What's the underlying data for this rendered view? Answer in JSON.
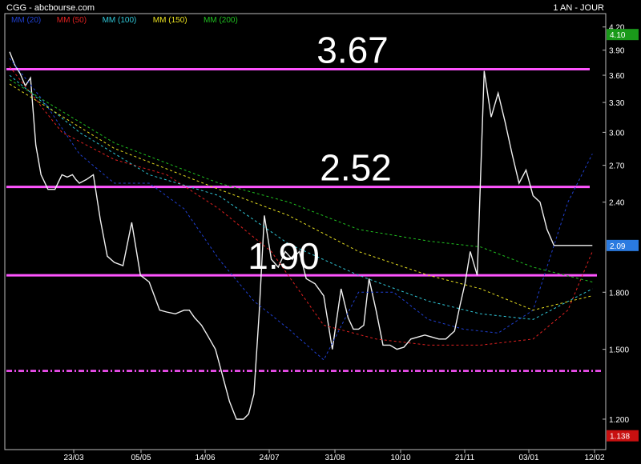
{
  "header": {
    "title": "CGG - abcbourse.com",
    "period": "1 AN - JOUR"
  },
  "chart_data": {
    "type": "line",
    "title": "CGG - abcbourse.com",
    "period": "1 AN - JOUR",
    "y_scale": "log",
    "ylim": [
      1.1,
      4.35
    ],
    "y_ticks": [
      4.2,
      3.9,
      3.6,
      3.3,
      3.0,
      2.7,
      2.4,
      1.8,
      1.5,
      1.2
    ],
    "y_tick_labels": [
      "4.20",
      "3.90",
      "3.60",
      "3.30",
      "3.00",
      "2.70",
      "2.40",
      "1.800",
      "1.500",
      "1.200"
    ],
    "x_tick_labels": [
      "23/03",
      "05/05",
      "14/06",
      "24/07",
      "31/08",
      "10/10",
      "21/11",
      "03/01",
      "12/02"
    ],
    "grid": false,
    "legend_position": "top-left",
    "legend": [
      {
        "label": "MM (20)",
        "color": "#1f3fd0"
      },
      {
        "label": "MM (50)",
        "color": "#e02020"
      },
      {
        "label": "MM (100)",
        "color": "#30c8d8"
      },
      {
        "label": "MM (150)",
        "color": "#e8e020"
      },
      {
        "label": "MM (200)",
        "color": "#20c020"
      }
    ],
    "price_badges": [
      {
        "label": "4.10",
        "value": 4.1,
        "color": "#1a9a1a"
      },
      {
        "label": "2.09",
        "value": 2.09,
        "color": "#2a7ae0"
      },
      {
        "label": "1.138",
        "value": 1.138,
        "color": "#c81010"
      }
    ],
    "annotations": [
      {
        "label": "3.67",
        "value": 3.67
      },
      {
        "label": "2.52",
        "value": 2.52
      },
      {
        "label": "1.90",
        "value": 1.9
      }
    ],
    "horizontal_lines": [
      {
        "value": 3.67,
        "style": "solid",
        "color": "#ff55ff"
      },
      {
        "value": 2.52,
        "style": "solid",
        "color": "#ff55ff"
      },
      {
        "value": 1.9,
        "style": "solid",
        "color": "#ff55ff"
      },
      {
        "value": 1.4,
        "style": "dash-dot",
        "color": "#ff55ff"
      }
    ],
    "series": [
      {
        "name": "Cours",
        "color": "#f0f0f0",
        "x": [
          0,
          3,
          6,
          9,
          12,
          15,
          18,
          22,
          26,
          30,
          33,
          36,
          38,
          40,
          44,
          48,
          52,
          56,
          60,
          65,
          70,
          75,
          80,
          86,
          90,
          95,
          100,
          103,
          106,
          110,
          114,
          118,
          122,
          126,
          130,
          134,
          137,
          140,
          143,
          146,
          150,
          154,
          158,
          162,
          166,
          170,
          175,
          180,
          185,
          190,
          194,
          197,
          200,
          203,
          206,
          210,
          214,
          218,
          222,
          226,
          230,
          234,
          238,
          242,
          246,
          250,
          255,
          258,
          261,
          264,
          268,
          272,
          276,
          280,
          284,
          288,
          292,
          296,
          300,
          304,
          308,
          312,
          316,
          320,
          324,
          326,
          328,
          330,
          332,
          334
        ],
        "values": [
          3.88,
          3.72,
          3.62,
          3.48,
          3.57,
          2.88,
          2.62,
          2.5,
          2.5,
          2.62,
          2.6,
          2.62,
          2.58,
          2.55,
          2.58,
          2.62,
          2.27,
          2.02,
          1.98,
          1.96,
          2.25,
          1.9,
          1.86,
          1.7,
          1.69,
          1.68,
          1.7,
          1.7,
          1.66,
          1.62,
          1.56,
          1.5,
          1.38,
          1.27,
          1.2,
          1.2,
          1.22,
          1.3,
          1.68,
          2.3,
          2.0,
          1.95,
          2.05,
          2.0,
          2.05,
          1.88,
          1.85,
          1.78,
          1.5,
          1.82,
          1.66,
          1.6,
          1.6,
          1.62,
          1.88,
          1.7,
          1.52,
          1.52,
          1.5,
          1.51,
          1.55,
          1.56,
          1.57,
          1.56,
          1.55,
          1.55,
          1.59,
          1.72,
          1.85,
          2.05,
          1.9,
          3.65,
          3.15,
          3.4,
          3.1,
          2.8,
          2.55,
          2.66,
          2.45,
          2.4,
          2.2,
          2.09,
          2.09,
          2.09,
          2.09,
          2.09,
          2.09,
          2.09,
          2.09,
          2.09
        ]
      },
      {
        "name": "MM (20)",
        "color": "#1f3fd0",
        "x": [
          0,
          20,
          40,
          60,
          80,
          100,
          120,
          140,
          160,
          180,
          200,
          220,
          240,
          260,
          280,
          300,
          320,
          334
        ],
        "values": [
          3.8,
          3.3,
          2.8,
          2.55,
          2.55,
          2.35,
          2.0,
          1.75,
          1.6,
          1.45,
          1.8,
          1.8,
          1.65,
          1.6,
          1.58,
          1.7,
          2.4,
          2.8
        ]
      },
      {
        "name": "MM (50)",
        "color": "#e02020",
        "x": [
          0,
          30,
          60,
          90,
          120,
          150,
          180,
          210,
          240,
          270,
          300,
          320,
          334
        ],
        "values": [
          3.7,
          3.0,
          2.75,
          2.62,
          2.35,
          2.05,
          1.62,
          1.55,
          1.52,
          1.52,
          1.55,
          1.7,
          2.05
        ]
      },
      {
        "name": "MM (100)",
        "color": "#30c8d8",
        "x": [
          0,
          40,
          80,
          120,
          160,
          200,
          240,
          270,
          300,
          334
        ],
        "values": [
          3.6,
          3.0,
          2.62,
          2.45,
          2.1,
          1.9,
          1.75,
          1.68,
          1.65,
          1.82
        ]
      },
      {
        "name": "MM (150)",
        "color": "#e8e020",
        "x": [
          0,
          60,
          120,
          160,
          200,
          240,
          270,
          300,
          334
        ],
        "values": [
          3.5,
          2.85,
          2.5,
          2.3,
          2.05,
          1.9,
          1.82,
          1.7,
          1.78
        ]
      },
      {
        "name": "MM (200)",
        "color": "#20c020",
        "x": [
          0,
          60,
          120,
          160,
          200,
          240,
          270,
          300,
          334
        ],
        "values": [
          3.55,
          2.9,
          2.55,
          2.4,
          2.2,
          2.12,
          2.08,
          1.95,
          1.86
        ]
      }
    ]
  }
}
